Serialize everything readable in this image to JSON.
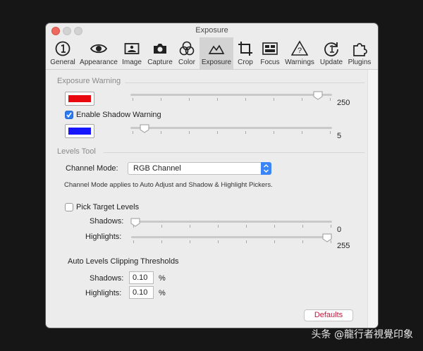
{
  "window": {
    "title": "Exposure"
  },
  "toolbar": {
    "tabs": [
      {
        "label": "General",
        "icon": "info-circle-icon"
      },
      {
        "label": "Appearance",
        "icon": "eye-icon"
      },
      {
        "label": "Image",
        "icon": "image-icon"
      },
      {
        "label": "Capture",
        "icon": "camera-icon"
      },
      {
        "label": "Color",
        "icon": "color-circles-icon"
      },
      {
        "label": "Exposure",
        "icon": "exposure-mountain-icon",
        "selected": true
      },
      {
        "label": "Crop",
        "icon": "crop-icon"
      },
      {
        "label": "Focus",
        "icon": "focus-icon"
      },
      {
        "label": "Warnings",
        "icon": "warning-triangle-icon"
      },
      {
        "label": "Update",
        "icon": "update-icon"
      },
      {
        "label": "Plugins",
        "icon": "puzzle-icon"
      }
    ]
  },
  "exposure_warning": {
    "title": "Exposure Warning",
    "highlight_color": "#e8090e",
    "highlight_value": "250",
    "highlight_level": 0.98,
    "enable_shadow_label": "Enable Shadow Warning",
    "enable_shadow_checked": true,
    "shadow_color": "#1616ff",
    "shadow_value": "5",
    "shadow_level": 0.02
  },
  "levels_tool": {
    "title": "Levels Tool",
    "channel_mode_label": "Channel Mode:",
    "channel_mode_value": "RGB Channel",
    "help_text": "Channel Mode applies to Auto Adjust and Shadow & Highlight Pickers.",
    "pick_target_label": "Pick Target Levels",
    "pick_target_checked": false,
    "shadows_label": "Shadows:",
    "shadows_value": "0",
    "shadows_level": 0.0,
    "highlights_label": "Highlights:",
    "highlights_value": "255",
    "highlights_level": 1.0,
    "clipping_title": "Auto Levels Clipping Thresholds",
    "clip_shadows_label": "Shadows:",
    "clip_shadows_value": "0.10",
    "clip_highlights_label": "Highlights:",
    "clip_highlights_value": "0.10",
    "percent": "%"
  },
  "footer": {
    "defaults_label": "Defaults"
  },
  "watermark": "头条 @龍行者視覺印象"
}
